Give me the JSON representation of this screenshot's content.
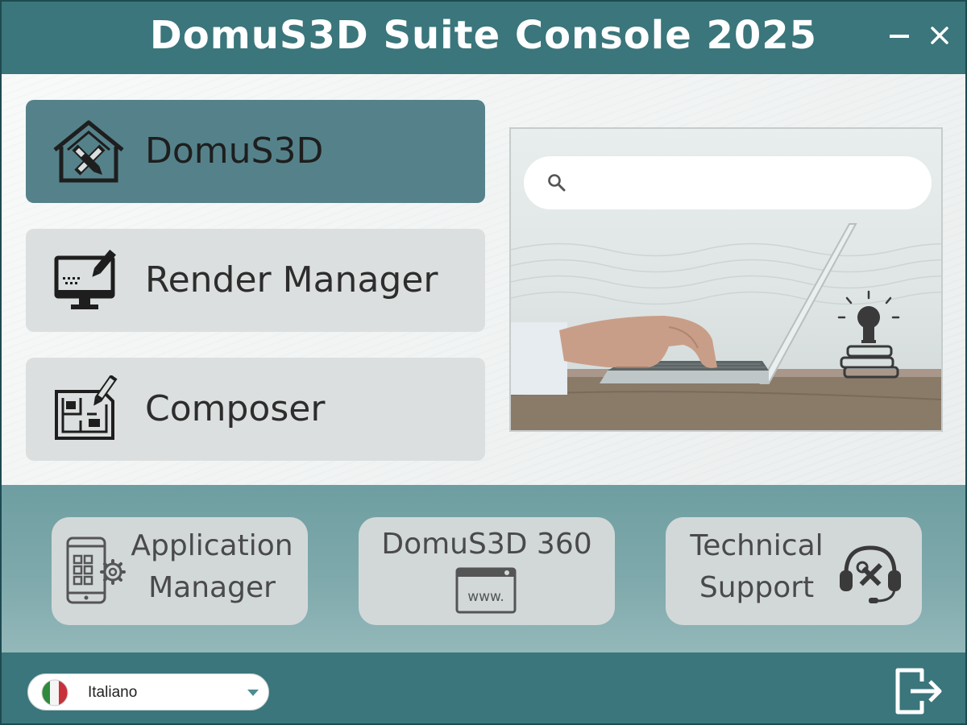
{
  "window": {
    "title": "DomuS3D Suite Console 2025",
    "minimize_glyph": "—",
    "close_glyph": "✕"
  },
  "nav": {
    "items": [
      {
        "label": "DomuS3D",
        "icon": "house-tools-icon",
        "active": true
      },
      {
        "label": "Render Manager",
        "icon": "monitor-pen-icon",
        "active": false
      },
      {
        "label": "Composer",
        "icon": "floorplan-pen-icon",
        "active": false
      }
    ]
  },
  "search": {
    "placeholder": "",
    "value": "",
    "icon": "search-icon"
  },
  "tiles": [
    {
      "label_line1": "Application",
      "label_line2": "Manager",
      "icon": "phone-gear-icon"
    },
    {
      "label_line1": "DomuS3D 360",
      "icon_text": "www.",
      "icon": "browser-www-icon"
    },
    {
      "label_line1": "Technical",
      "label_line2": "Support",
      "icon": "headset-tools-icon"
    }
  ],
  "footer": {
    "language": "Italiano",
    "flag": "italy-flag-icon",
    "exit_icon": "exit-icon"
  },
  "colors": {
    "titlebar": "#3a767b",
    "active_nav": "#55828a",
    "nav": "#dcdfdf",
    "tile": "#d2d8d8"
  }
}
